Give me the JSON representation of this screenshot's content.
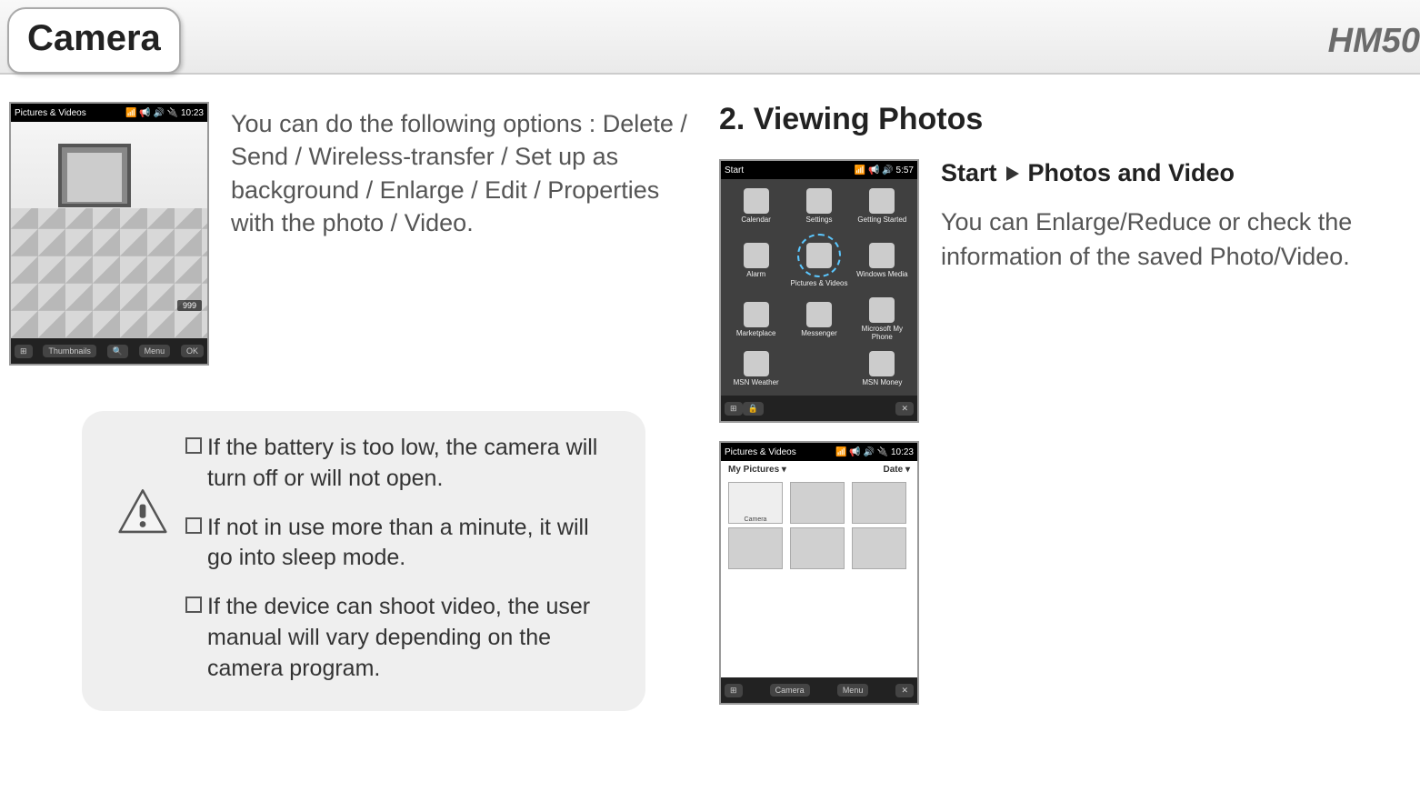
{
  "header": {
    "tab_title": "Camera",
    "model": "HM50"
  },
  "left": {
    "screenshot": {
      "title": "Pictures & Videos",
      "status": "📶 📢 🔊 🔌 10:23",
      "badge": "999",
      "btn_left": "Thumbnails",
      "btn_menu": "Menu",
      "btn_ok": "OK"
    },
    "description": "You can do the following options : Delete / Send / Wireless-transfer / Set up as background / Enlarge / Edit / Properties with the photo / Video.",
    "notes": [
      "If the battery is too low, the camera will turn off or will not open.",
      "If not in use more than a minute, it will go into sleep mode.",
      "If the device can shoot video, the user manual will vary depending on the camera program."
    ]
  },
  "right": {
    "heading": "2. Viewing Photos",
    "breadcrumb": {
      "a": "Start",
      "b": "Photos and Video"
    },
    "description": "You can Enlarge/Reduce or check the information of the saved Photo/Video.",
    "start_screen": {
      "title": "Start",
      "status": "📶 📢 🔊 5:57",
      "icons": [
        "Calendar",
        "Settings",
        "Getting Started",
        "Alarm",
        "Pictures & Videos",
        "Windows Media",
        "Marketplace",
        "Messenger",
        "Microsoft My Phone",
        "MSN Weather",
        "",
        "MSN Money"
      ]
    },
    "gallery_screen": {
      "title": "Pictures & Videos",
      "status": "📶 📢 🔊 🔌 10:23",
      "folder": "My Pictures",
      "sort": "Date",
      "thumb_camera": "Camera",
      "btn_camera": "Camera",
      "btn_menu": "Menu"
    }
  }
}
